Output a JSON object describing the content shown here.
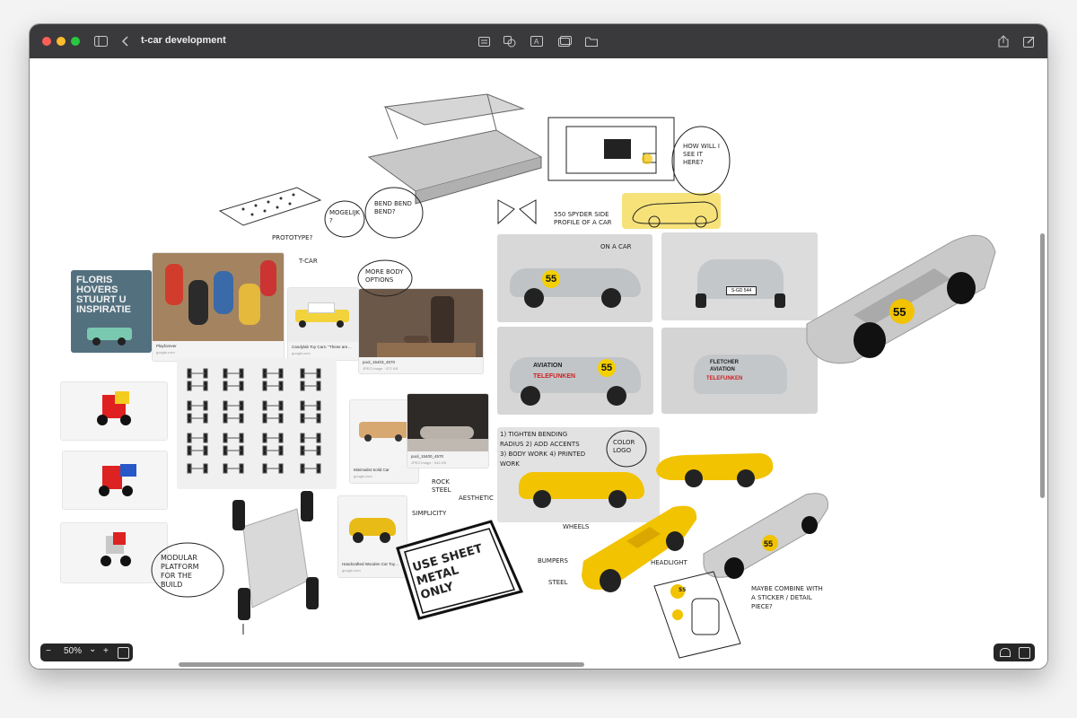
{
  "window": {
    "title": "t-car development"
  },
  "toolbar": {
    "icons": [
      "sidebar-icon",
      "back-icon",
      "note-icon",
      "shapes-icon",
      "text-box-icon",
      "media-icon",
      "folder-icon",
      "share-icon",
      "compose-icon"
    ]
  },
  "cards": {
    "floris": {
      "line1": "FLORIS",
      "line2": "HOVERS",
      "line3": "STUURT U",
      "line4": "INSPIRATIE"
    },
    "playforever": {
      "title": "Playforever",
      "source": "google.com"
    },
    "candylab": {
      "title": "Candylab Toy Cars: \"These are…",
      "source": "google.com"
    },
    "pool1": {
      "title": "pool_15403_4570",
      "source": "JPEG image · 572 KB"
    },
    "pool2": {
      "title": "pool_15400_4570",
      "source": "JPEG image · 544 KB"
    },
    "minimalist": {
      "title": "Minimalist Solid Car",
      "source": "google.com"
    },
    "handcrafted": {
      "title": "Handcrafted Wooden Car Toy…",
      "source": "google.com"
    }
  },
  "car": {
    "number": "55",
    "plate": "S-GD 544",
    "sponsor1": "FLETCHER",
    "sponsor2": "AVIATION",
    "sponsor3": "TELEFUNKEN"
  },
  "notes": {
    "how_will": "HOW WILL I SEE IT HERE?",
    "bend": "BEND BEND BEND?",
    "mogelijk": "MOGELIJK ?",
    "prototype": "PROTOTYPE?",
    "tcar": "T-CAR",
    "more_body": "MORE BODY OPTIONS",
    "side_profile": "550 SPYDER SIDE PROFILE OF A CAR",
    "on_a_car": "ON A CAR",
    "list": "1) TIGHTEN BENDING RADIUS   2) ADD ACCENTS   3) BODY WORK   4) PRINTED WORK",
    "color_logo": "COLOR LOGO",
    "use_sheet": "USE SHEET METAL ONLY",
    "modular": "MODULAR PLATFORM FOR THE BUILD",
    "maybe": "MAYBE COMBINE WITH A STICKER / DETAIL PIECE?",
    "simplicity": "SIMPLICITY",
    "aesthetic": "AESTHETIC",
    "rock_steel": "ROCK STEEL",
    "wheels": "WHEELS",
    "bumpers": "BUMPERS",
    "headlight": "HEADLIGHT",
    "steel": "STEEL",
    "sticker": "55"
  },
  "zoom": {
    "value": "50%",
    "minus": "−",
    "plus": "+",
    "chevron": "⌄"
  },
  "colors": {
    "titlebar": "#3a3a3c",
    "yellow": "#f2c300",
    "highlight": "#f7e27a",
    "silver": "#c9c9c9"
  }
}
